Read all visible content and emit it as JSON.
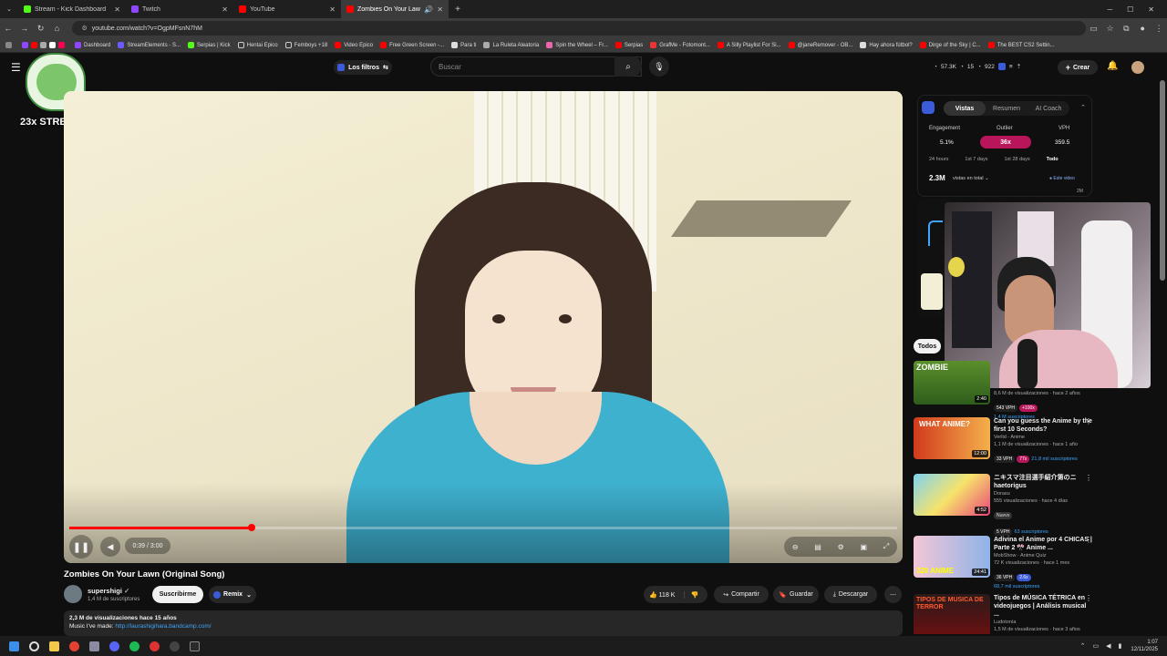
{
  "browser": {
    "tabs": [
      {
        "title": "Stream - Kick Dashboard",
        "color": "#53fc18"
      },
      {
        "title": "Twitch",
        "color": "#9146ff"
      },
      {
        "title": "YouTube",
        "color": "#ff0000"
      },
      {
        "title": "Zombies On Your Lawn (O...",
        "color": "#ff0000"
      }
    ],
    "url": "youtube.com/watch?v=OgpMFsnN7hM",
    "bookmarks": [
      "Dashboard",
      "StreamElements - S...",
      "Serpias | Kick",
      "Hentai Epico",
      "Femboys +18",
      "Video Epico",
      "Free Green Screen -...",
      "Para ti",
      "La Ruleta Aleatoria",
      "Spin the Wheel – Fr...",
      "Serpias",
      "GrafMe - Fotomont...",
      "A Silly Playlist For Si...",
      "@janeRemover - OB...",
      "Hay ahora fútbol?",
      "Dirge of the Sky | C...",
      "The BEST CS2 Settin..."
    ]
  },
  "overlay": {
    "streak_label": "23x STREAK"
  },
  "youtube": {
    "filters_label": "Los filtros",
    "search_placeholder": "Buscar",
    "stats": {
      "views": "57.3K",
      "likes": "15",
      "comments": "922"
    },
    "create_label": "Crear"
  },
  "player": {
    "time": "0:39 / 3:00",
    "progress": 0.22
  },
  "video": {
    "title": "Zombies On Your Lawn (Original Song)",
    "channel": "supershigi",
    "subscribers": "1,4 M de suscriptores",
    "subscribe_label": "Suscribirme",
    "remix_label": "Remix",
    "likes": "118 K",
    "share_label": "Compartir",
    "save_label": "Guardar",
    "download_label": "Descargar",
    "desc_views": "2,3 M de visualizaciones  hace 15 años",
    "desc_music": "Music I've made:",
    "desc_link": "http://laurashigihara.bandcamp.com/"
  },
  "analytics": {
    "tabs": [
      "Vistas",
      "Resumen",
      "AI Coach"
    ],
    "engagement_label": "Engagement",
    "engagement_value": "5.1%",
    "outlier_label": "Outlier",
    "outlier_value": "36x",
    "vph_label": "VPH",
    "vph_value": "359.5",
    "ranges": [
      "24 hours",
      "1st 7 days",
      "1st 28 days",
      "Todo"
    ],
    "total_views": "2.3M",
    "total_label": "vistas en total",
    "legend": "Este video",
    "axis_label": "2M"
  },
  "recommended": {
    "chip": "Todos",
    "items": [
      {
        "title": "",
        "meta1": "8,6 M de visualizaciones · hace 2 años",
        "vph": "543 VPH",
        "outlier": "+100x",
        "subs": "1,4 M suscriptores",
        "duration": "2:40",
        "thumb_label": "ZOMBIE"
      },
      {
        "title": "Can you guess the Anime by the first 10 Seconds?",
        "channel": "Verlid - Anime",
        "meta1": "1,1 M de visualizaciones · hace 1 año",
        "vph": "33 VPH",
        "outlier": "77x",
        "subs": "21,8 mil suscriptores",
        "duration": "12:00",
        "thumb_label": "WHAT ANIME?"
      },
      {
        "title": "ニキスマ注目選手紹介第のニ haetorigus",
        "channel": "Dorasu",
        "meta1": "555 visualizaciones · hace 4 días",
        "badge": "Nuevo",
        "vph": "5 VPH",
        "subs": "63 suscriptores",
        "duration": "4:52",
        "thumb_label": ""
      },
      {
        "title": "Adivina el Anime por 4 CHICAS | Parte 2 🎌 Anime ...",
        "channel": "MobShow · Anime Quiz",
        "meta1": "72 K visualizaciones · hace 1 mes",
        "vph": "36 VPH",
        "outlier": "2.6x",
        "subs": "68,7 mil suscriptores",
        "duration": "24:41",
        "thumb_label": "320 ANIME"
      },
      {
        "title": "Tipos de MÚSICA TÉTRICA en videojuegos | Análisis musical ...",
        "channel": "Ludotonía",
        "meta1": "1,5 M de visualizaciones · hace 3 años",
        "duration": "",
        "thumb_label": "TIPOS DE MUSICA DE TERROR"
      }
    ]
  },
  "taskbar": {
    "time": "1:07",
    "date": "12/11/2025"
  }
}
